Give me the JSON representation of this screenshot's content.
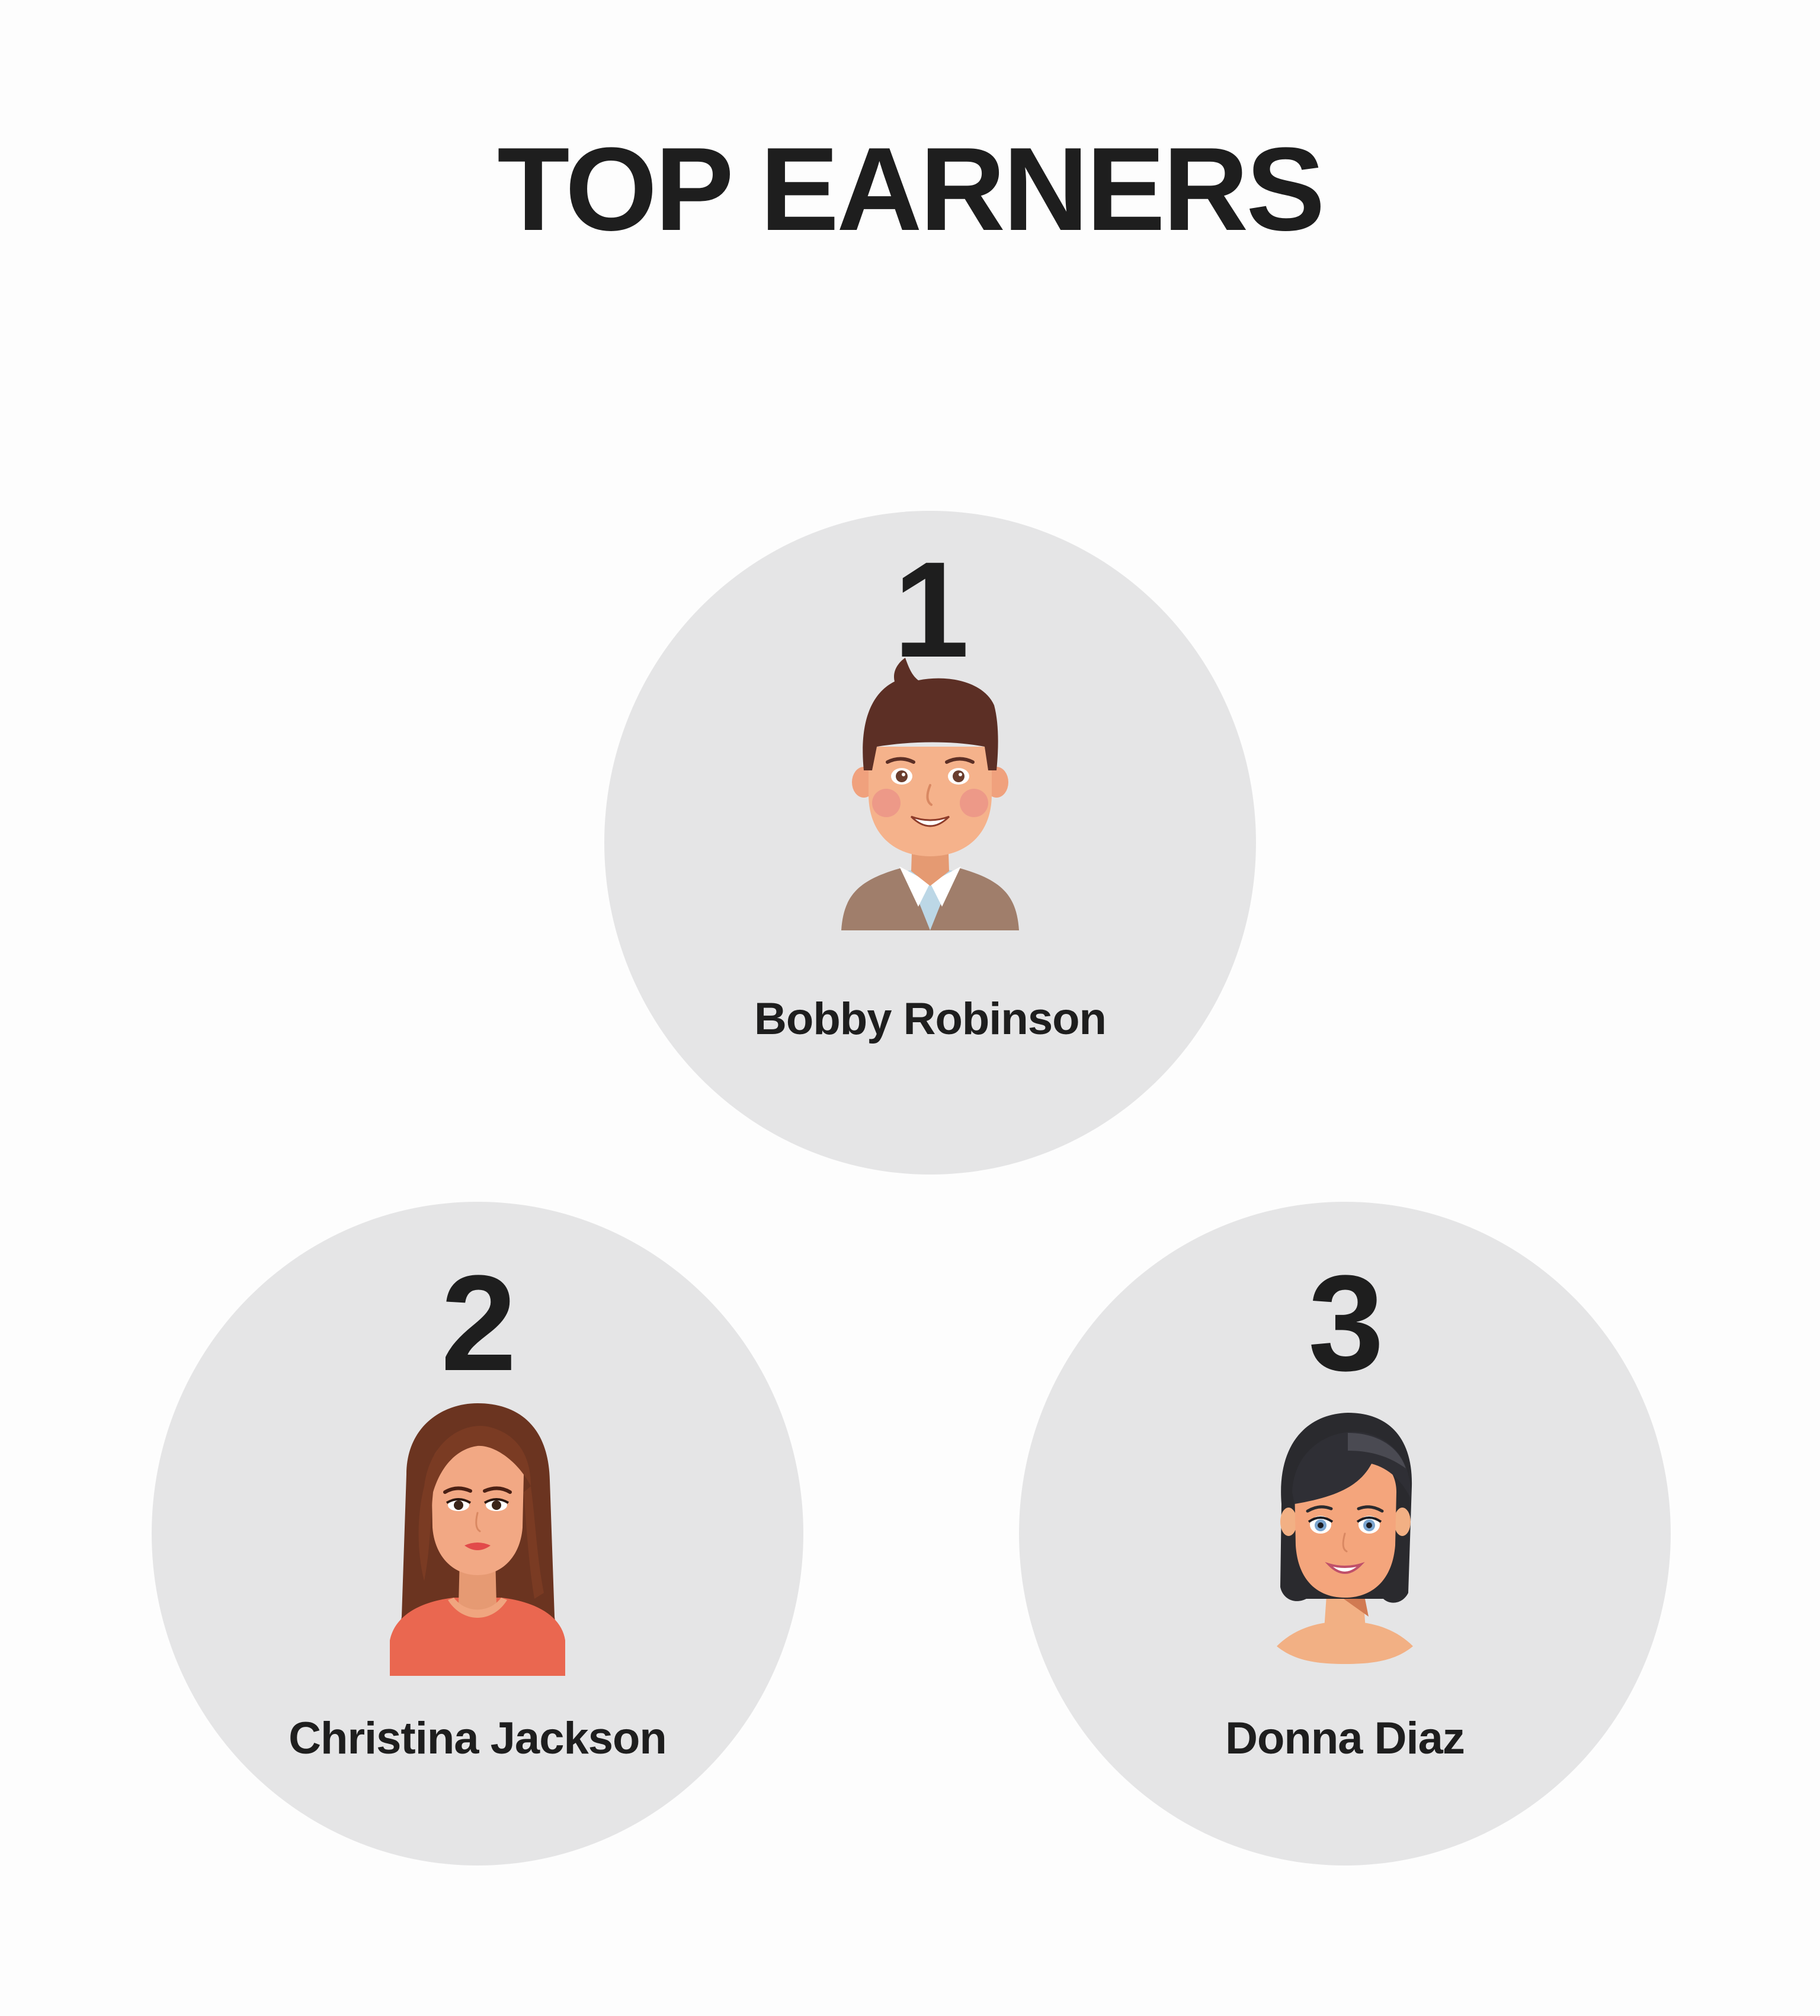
{
  "page": {
    "title": "TOP EARNERS"
  },
  "earners": [
    {
      "rank": "1",
      "name": "Bobby Robinson",
      "avatar": "male-avatar-icon"
    },
    {
      "rank": "2",
      "name": "Christina Jackson",
      "avatar": "female-long-hair-avatar-icon"
    },
    {
      "rank": "3",
      "name": "Donna Diaz",
      "avatar": "female-short-hair-avatar-icon"
    }
  ],
  "colors": {
    "background": "#fdfdfd",
    "card": "#e5e5e6",
    "text": "#1e1e1e"
  }
}
